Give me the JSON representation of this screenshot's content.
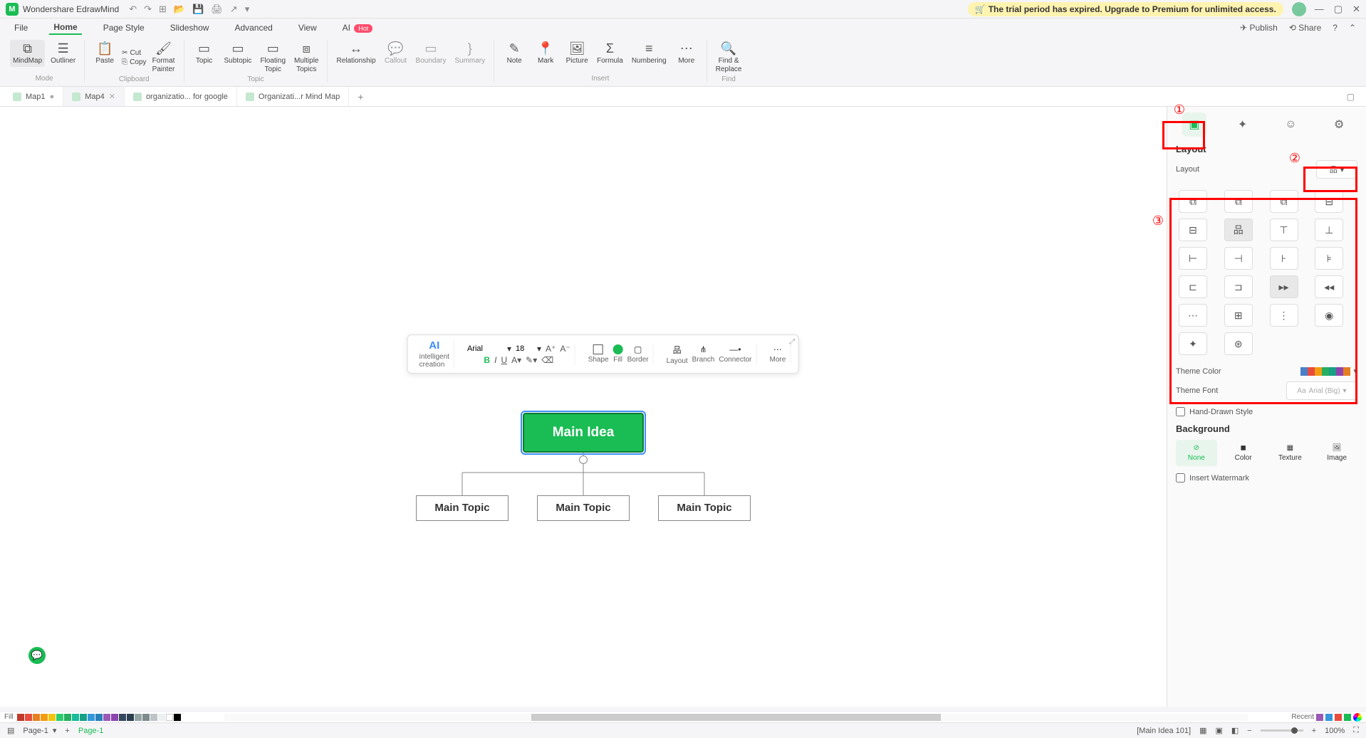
{
  "app": {
    "title": "Wondershare EdrawMind"
  },
  "trial_banner": "The trial period has expired. Upgrade to Premium for unlimited access.",
  "menu": {
    "items": [
      "File",
      "Home",
      "Page Style",
      "Slideshow",
      "Advanced",
      "View"
    ],
    "ai": "AI",
    "ai_badge": "Hot",
    "publish": "Publish",
    "share": "Share"
  },
  "ribbon": {
    "mode": {
      "mindmap": "MindMap",
      "outliner": "Outliner",
      "label": "Mode"
    },
    "clipboard": {
      "paste": "Paste",
      "cut": "Cut",
      "copy": "Copy",
      "format_painter": "Format\nPainter",
      "label": "Clipboard"
    },
    "topic": {
      "topic": "Topic",
      "subtopic": "Subtopic",
      "floating": "Floating\nTopic",
      "multiple": "Multiple\nTopics",
      "label": "Topic"
    },
    "relationship": "Relationship",
    "callout": "Callout",
    "boundary": "Boundary",
    "summary": "Summary",
    "insert": {
      "note": "Note",
      "mark": "Mark",
      "picture": "Picture",
      "formula": "Formula",
      "numbering": "Numbering",
      "more": "More",
      "label": "Insert"
    },
    "find": {
      "label": "Find &\nReplace",
      "sublabel": "Find"
    }
  },
  "doc_tabs": [
    {
      "name": "Map1",
      "modified": true
    },
    {
      "name": "Map4",
      "active": true
    },
    {
      "name": "organizatio... for google"
    },
    {
      "name": "Organizati...r Mind Map"
    }
  ],
  "mindmap": {
    "main": "Main Idea",
    "topics": [
      "Main Topic",
      "Main Topic",
      "Main Topic"
    ]
  },
  "float_toolbar": {
    "ai": "AI",
    "ai_label": "intelligent\ncreation",
    "font": "Arial",
    "size": "18",
    "bold": "B",
    "italic": "I",
    "underline": "U",
    "shape": "Shape",
    "fill": "Fill",
    "border": "Border",
    "layout": "Layout",
    "branch": "Branch",
    "connector": "Connector",
    "more": "More"
  },
  "right_panel": {
    "layout_title": "Layout",
    "layout_label": "Layout",
    "theme_color": "Theme Color",
    "theme_font": "Theme Font",
    "theme_font_value": "Arial (Big)",
    "hand_drawn": "Hand-Drawn Style",
    "background": "Background",
    "bg_none": "None",
    "bg_color": "Color",
    "bg_texture": "Texture",
    "bg_image": "Image",
    "watermark": "Insert Watermark"
  },
  "annotations": {
    "n1": "①",
    "n2": "②",
    "n3": "③"
  },
  "color_bar": {
    "fill": "Fill",
    "recent": "Recent"
  },
  "status": {
    "page": "Page-1",
    "page_label": "Page-1",
    "main_idea": "[Main Idea 101]",
    "zoom": "100%"
  }
}
